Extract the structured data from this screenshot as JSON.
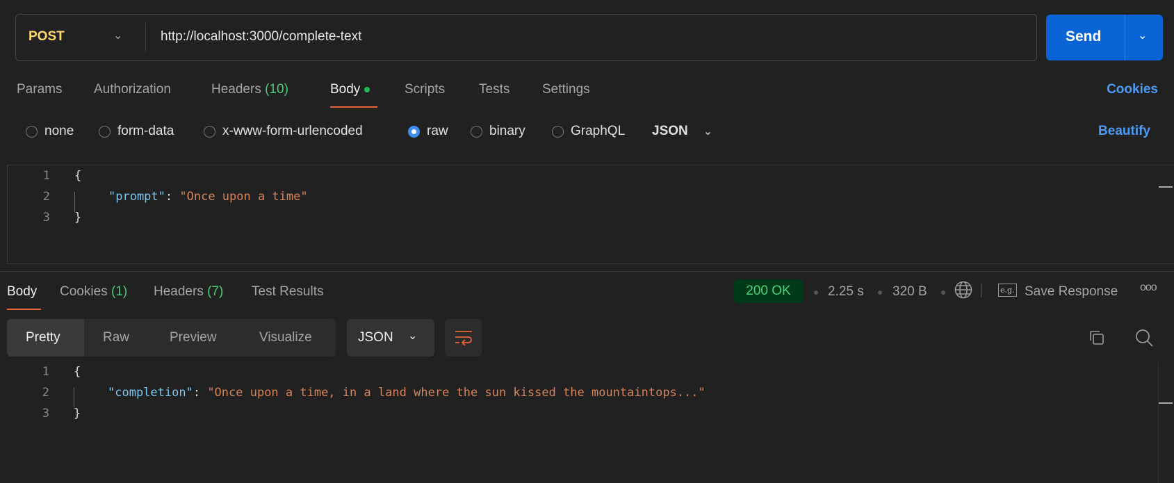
{
  "request": {
    "method": "POST",
    "url": "http://localhost:3000/complete-text",
    "send_label": "Send"
  },
  "req_tabs": {
    "params": "Params",
    "authorization": "Authorization",
    "headers": "Headers",
    "headers_count": "(10)",
    "body": "Body",
    "scripts": "Scripts",
    "tests": "Tests",
    "settings": "Settings",
    "cookies": "Cookies"
  },
  "body_types": {
    "none": "none",
    "form_data": "form-data",
    "urlencoded": "x-www-form-urlencoded",
    "raw": "raw",
    "binary": "binary",
    "graphql": "GraphQL",
    "format": "JSON",
    "beautify": "Beautify",
    "selected": "raw"
  },
  "request_body": {
    "lines": [
      "1",
      "2",
      "3"
    ],
    "open": "{",
    "key": "\"prompt\"",
    "colon": ": ",
    "value": "\"Once upon a time\"",
    "close": "}"
  },
  "resp_tabs": {
    "body": "Body",
    "cookies": "Cookies",
    "cookies_count": "(1)",
    "headers": "Headers",
    "headers_count": "(7)",
    "test_results": "Test Results"
  },
  "response_meta": {
    "status": "200 OK",
    "time": "2.25 s",
    "size": "320 B",
    "save": "Save Response",
    "eg": "e.g."
  },
  "view_modes": {
    "pretty": "Pretty",
    "raw": "Raw",
    "preview": "Preview",
    "visualize": "Visualize",
    "format": "JSON"
  },
  "response_body": {
    "lines": [
      "1",
      "2",
      "3"
    ],
    "open": "{",
    "key": "\"completion\"",
    "colon": ": ",
    "value": "\"Once upon a time, in a land where the sun kissed the mountaintops...\"",
    "close": "}"
  },
  "colors": {
    "accent": "#0a64d6",
    "status_ok": "#4fd07c",
    "active_underline": "#e8653c",
    "method": "#ffd86b"
  }
}
